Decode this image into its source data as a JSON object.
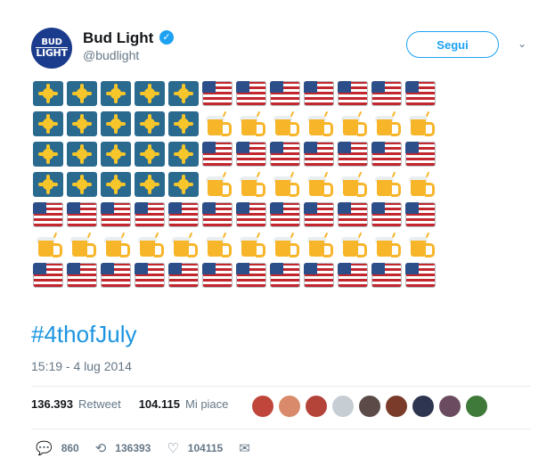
{
  "account": {
    "name": "Bud Light",
    "handle": "@budlight",
    "avatar_line1": "BUD",
    "avatar_line2": "LIGHT",
    "verified_icon": "verified-badge-icon"
  },
  "follow_label": "Segui",
  "tweet": {
    "hashtag": "#4thofJuly",
    "timestamp": "15:19 - 4 lug 2014",
    "emoji_rows": [
      [
        "sun",
        "sun",
        "sun",
        "sun",
        "sun",
        "flag",
        "flag",
        "flag",
        "flag",
        "flag",
        "flag",
        "flag"
      ],
      [
        "sun",
        "sun",
        "sun",
        "sun",
        "sun",
        "beer",
        "beer",
        "beer",
        "beer",
        "beer",
        "beer",
        "beer"
      ],
      [
        "sun",
        "sun",
        "sun",
        "sun",
        "sun",
        "flag",
        "flag",
        "flag",
        "flag",
        "flag",
        "flag",
        "flag"
      ],
      [
        "sun",
        "sun",
        "sun",
        "sun",
        "sun",
        "beer",
        "beer",
        "beer",
        "beer",
        "beer",
        "beer",
        "beer"
      ],
      [
        "flag",
        "flag",
        "flag",
        "flag",
        "flag",
        "flag",
        "flag",
        "flag",
        "flag",
        "flag",
        "flag",
        "flag"
      ],
      [
        "beer",
        "beer",
        "beer",
        "beer",
        "beer",
        "beer",
        "beer",
        "beer",
        "beer",
        "beer",
        "beer",
        "beer"
      ],
      [
        "flag",
        "flag",
        "flag",
        "flag",
        "flag",
        "flag",
        "flag",
        "flag",
        "flag",
        "flag",
        "flag",
        "flag"
      ]
    ]
  },
  "stats": {
    "retweets_count": "136.393",
    "retweets_label": "Retweet",
    "likes_count": "104.115",
    "likes_label": "Mi piace"
  },
  "likers_colors": [
    "#c0463c",
    "#d98a6b",
    "#b4433a",
    "#c6cdd3",
    "#5b4a48",
    "#7a3b2a",
    "#2d3550",
    "#6b4b5f",
    "#3f7a3a"
  ],
  "actions": {
    "reply_icon": "reply-icon",
    "reply_count": "860",
    "retweet_icon": "retweet-icon",
    "retweet_count": "136393",
    "like_icon": "heart-icon",
    "like_count": "104115",
    "dm_icon": "envelope-icon"
  }
}
